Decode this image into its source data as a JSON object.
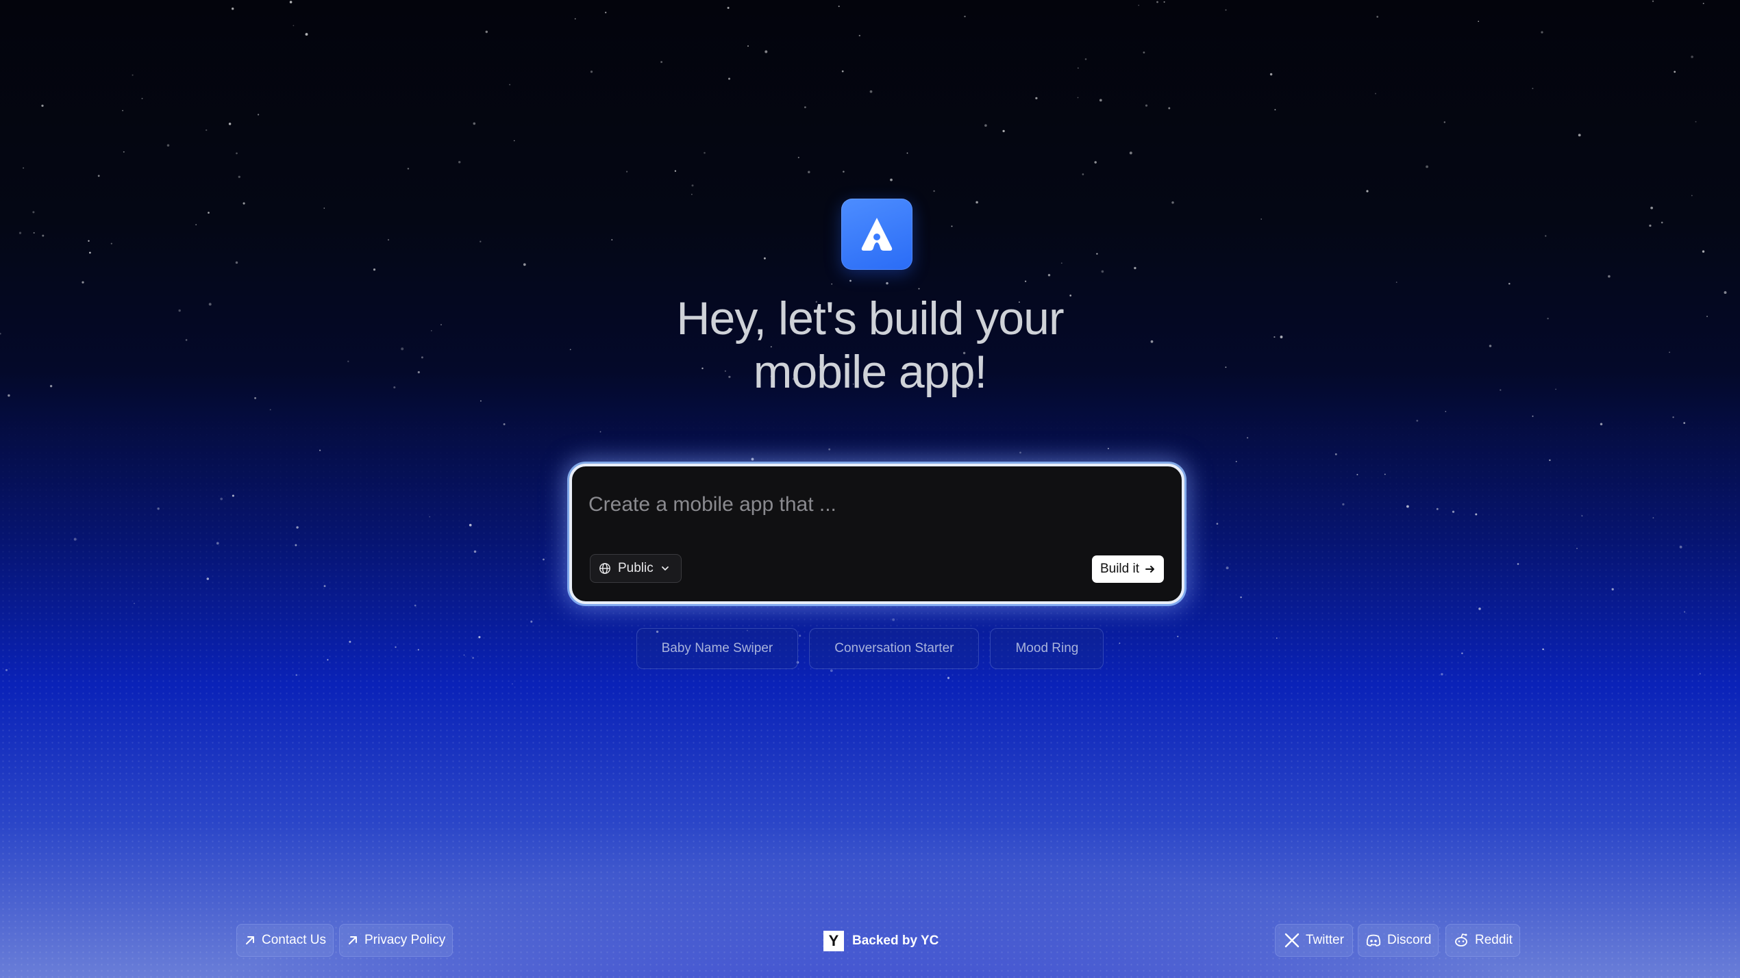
{
  "app": {
    "logo_icon": "app-logo-a-icon",
    "accent_color": "#2f73ff"
  },
  "headline": {
    "line1": "Hey, let's build your",
    "line2": "mobile app!"
  },
  "prompt": {
    "value": "",
    "placeholder": "Create a mobile app that ...",
    "visibility": {
      "label": "Public",
      "icon": "globe-icon",
      "dropdown_icon": "chevron-down-icon"
    },
    "submit": {
      "label": "Build it",
      "icon": "arrow-right-icon"
    }
  },
  "suggestions": [
    {
      "label": "Baby Name Swiper"
    },
    {
      "label": "Conversation Starter"
    },
    {
      "label": "Mood Ring"
    }
  ],
  "footer": {
    "left_links": [
      {
        "label": "Contact Us",
        "icon": "external-arrow-icon"
      },
      {
        "label": "Privacy Policy",
        "icon": "external-arrow-icon"
      }
    ],
    "backed": {
      "badge": "Y",
      "label": "Backed by YC"
    },
    "social": [
      {
        "label": "Twitter",
        "icon": "x-twitter-icon"
      },
      {
        "label": "Discord",
        "icon": "discord-icon"
      },
      {
        "label": "Reddit",
        "icon": "reddit-icon"
      }
    ]
  }
}
